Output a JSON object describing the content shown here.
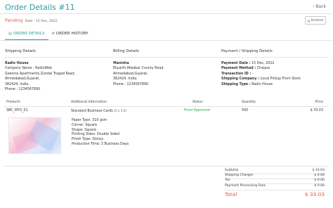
{
  "header": {
    "title": "Order Details #11",
    "back_label": "Back",
    "back_icon": "chevron-left-icon",
    "status": "Pending",
    "date": "Date : 15 Dec, 2022",
    "invoice_label": "Invoice",
    "invoice_icon": "printer-icon"
  },
  "tabs": [
    {
      "label": "ORDER DETAILS",
      "icon": "document-icon",
      "active": true
    },
    {
      "label": "ORDER HISTORY",
      "icon": "history-icon",
      "active": false
    }
  ],
  "shipping": {
    "title": "Shipping Details",
    "name": "Radix House",
    "lines": [
      "Company Name : RadixWeb",
      "Geeorra Apartments,Zundal Tragad Road,",
      "Ahmedabad,Gujarat,",
      "382424, India.",
      "Phone : 1234567890"
    ]
  },
  "billing": {
    "title": "Billing Details",
    "name": "Manisha",
    "lines": [
      "Ekyarth,Malabar County Road,",
      "Ahmedabad,Gujarat,",
      "382424, India.",
      "Phone : 1234567890"
    ]
  },
  "payment": {
    "title": "Payment / Shipping Details",
    "lines": [
      {
        "label": "Payment Date :",
        "value": "15 Dec, 2022"
      },
      {
        "label": "Payment Method :",
        "value": "Cheque"
      },
      {
        "label": "Transaction ID :",
        "value": "-"
      },
      {
        "label": "Shipping Company :",
        "value": "Local Pickup From Store"
      },
      {
        "label": "Shipping Type :",
        "value": "Radix House"
      }
    ]
  },
  "items_table": {
    "headers": {
      "products": "Products",
      "info": "Additional Information",
      "status": "Status",
      "quantity": "Quantity",
      "price": "Price"
    },
    "rows": [
      {
        "sku": "SBC_MYS_01",
        "name": "Standard Business Cards",
        "size": "(2 x 3.5)",
        "status": "Proof Approved",
        "quantity": "500",
        "price": "$ 33.03",
        "specs": [
          "Paper Type: 310 gsm",
          "Corner: Square",
          "Shape: Square",
          "Printing Sides: Double Sided",
          "Finish Type: Glossy",
          "Production Time: 3 Business Days"
        ]
      }
    ]
  },
  "summary": {
    "rows": [
      {
        "label": "Subtotal",
        "value": "$ 33.03"
      },
      {
        "label": "Shipping Charges",
        "value": "$ 0.00"
      },
      {
        "label": "Tax",
        "value": "$ 0.00"
      },
      {
        "label": "Payment Processing Fees",
        "value": "$ 0.00"
      }
    ],
    "total_label": "Total",
    "total_value": "$ 33.03"
  },
  "colors": {
    "accent": "#2a9d9f",
    "pending": "#e25a45",
    "approved": "#3aa655"
  }
}
